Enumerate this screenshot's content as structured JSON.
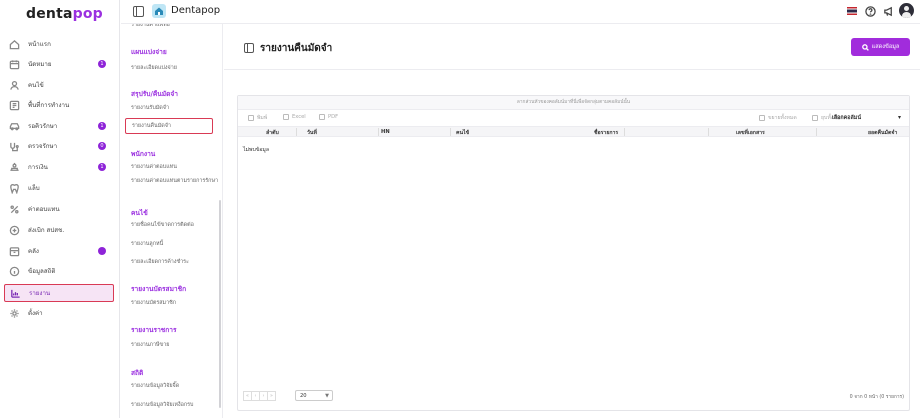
{
  "app": {
    "logo_main": "denta",
    "logo_accent": "pop",
    "clinic_name": "Dentapop"
  },
  "sidebar": {
    "items": [
      {
        "label": "หน้าแรก",
        "icon": "home-icon",
        "badge": ""
      },
      {
        "label": "นัดหมาย",
        "icon": "calendar-icon",
        "badge": "1"
      },
      {
        "label": "คนไข้",
        "icon": "user-icon",
        "badge": ""
      },
      {
        "label": "พื้นที่การทำงาน",
        "icon": "workspace-icon",
        "badge": ""
      },
      {
        "label": "รอคิวรักษา",
        "icon": "car-icon",
        "badge": "1"
      },
      {
        "label": "ตรวจรักษา",
        "icon": "treatment-icon",
        "badge": "0"
      },
      {
        "label": "การเงิน",
        "icon": "money-icon",
        "badge": "1"
      },
      {
        "label": "แล็บ",
        "icon": "tooth-icon",
        "badge": ""
      },
      {
        "label": "ค่าตอบแทน",
        "icon": "percent-icon",
        "badge": ""
      },
      {
        "label": "ส่งเบิก สปสช.",
        "icon": "send-icon",
        "badge": ""
      },
      {
        "label": "คลัง",
        "icon": "stock-icon",
        "badge": "•"
      },
      {
        "label": "ข้อมูลสถิติ",
        "icon": "info-icon",
        "badge": ""
      },
      {
        "label": "รายงาน",
        "icon": "report-chart-icon",
        "badge": ""
      },
      {
        "label": "ตั้งค่า",
        "icon": "settings-gear-icon",
        "badge": ""
      }
    ]
  },
  "report_menu": {
    "top_partial": "รายงานค่าแพทย์",
    "sections": [
      {
        "title": "แผนแบ่งจ่าย",
        "items": [
          "รายละเอียดแบ่งจ่าย"
        ]
      },
      {
        "title": "สรุปรับ/คืนมัดจำ",
        "items": [
          "รายงานรับมัดจำ",
          "รายงานคืนมัดจำ"
        ]
      },
      {
        "title": "พนักงาน",
        "items": [
          "รายงานค่าตอบแทน",
          "รายงานค่าตอบแทนตามรายการรักษา"
        ]
      },
      {
        "title": "คนไข้",
        "items": [
          "รายชื่อคนไข้ขาดการติดต่อ",
          "รายงานลูกหนี้",
          "รายละเอียดการค้างชำระ"
        ]
      },
      {
        "title": "รายงานบัตรสมาชิก",
        "items": [
          "รายงานบัตรสมาชิก"
        ]
      },
      {
        "title": "รายงานราชการ",
        "items": [
          "รายงานภาษีขาย"
        ]
      },
      {
        "title": "สถิติ",
        "items": [
          "รายงานข้อมูลวิจัยจิ๊ด",
          "รายงานข้อมูลวิจัยเหงือกรบ"
        ]
      }
    ]
  },
  "main": {
    "title": "รายงานคืนมัดจำ",
    "show_button": "แสดงข้อมูล",
    "drag_hint": "ลากส่วนหัวของคอลัมน์มาที่นี่เพื่อจัดกลุ่มตามคอลัมน์นั้น",
    "toolbar": {
      "print": "พิมพ์",
      "excel": "Excel",
      "pdf": "PDF",
      "expand_all": "ขยายทั้งหมด",
      "collapse_all": "ยุบทั้งหมด",
      "select_columns": "เลือกคอลัมน์"
    },
    "columns": [
      "ลำดับ",
      "วันที่",
      "HN",
      "คนไข้",
      "ชื่อรายการ",
      "เลขที่เอกสาร",
      "ยอดคืนมัดจำ"
    ],
    "empty_text": "ไม่พบข้อมูล",
    "pager": {
      "buttons": [
        "«",
        "‹",
        "›",
        "»"
      ],
      "page_size": "20",
      "info": "0 จาก 0 หน้า (0 รายการ)"
    }
  },
  "colors": {
    "accent": "#a12cdc",
    "badge": "#8e24d8",
    "active_border": "#d93a55"
  }
}
